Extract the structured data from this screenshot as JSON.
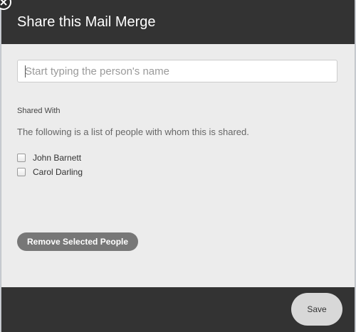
{
  "modal": {
    "title": "Share this Mail Merge"
  },
  "search": {
    "placeholder": "Start typing the person's name",
    "value": ""
  },
  "shared_with": {
    "label": "Shared With",
    "description": "The following is a list of people with whom this is shared.",
    "people": [
      {
        "name": "John Barnett",
        "checked": false
      },
      {
        "name": "Carol Darling",
        "checked": false
      }
    ]
  },
  "actions": {
    "remove_label": "Remove Selected People",
    "save_label": "Save"
  },
  "icons": {
    "close": "close-icon",
    "checkbox": "checkbox-icon"
  },
  "colors": {
    "header_bg": "#333333",
    "body_bg": "#ececec",
    "remove_button_bg": "#777777",
    "save_button_bg": "#d8d8d8"
  }
}
